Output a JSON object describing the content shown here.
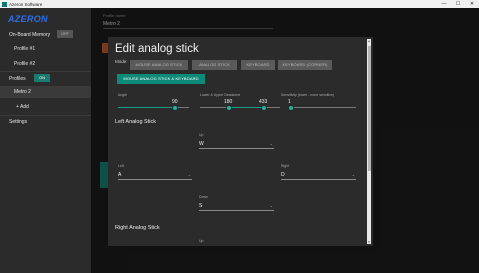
{
  "window": {
    "title": "Azeron Software",
    "controls": [
      "—",
      "☐",
      "✕"
    ]
  },
  "sidebar": {
    "logo": "AZERON",
    "onboard_memory": "On-Board Memory",
    "onboard_toggle": "OFF",
    "profile1": "Profile #1",
    "profile2": "Profile #2",
    "profiles_label": "Profiles",
    "profiles_toggle": "ON",
    "active_profile": "Metro 2",
    "add": "+ Add",
    "settings": "Settings"
  },
  "main": {
    "profile_name_label": "Profile name",
    "profile_name": "Metro 2"
  },
  "dialog": {
    "title": "Edit analog stick",
    "mode_label": "Mode:",
    "modes": [
      "MOUSE ANALOG STICK",
      "ANALOG STICK",
      "KEYBOARD",
      "KEYBOARD (CORNER)"
    ],
    "active_mode": "MOUSE ANALOG STICK & KEYBOARD",
    "angle_label": "Angle",
    "angle_value": "90",
    "deadzone_label": "Lower & Upper Deadzone",
    "deadzone_lower": "180",
    "deadzone_upper": "433",
    "sensitivity_label": "Sensitivity (lower - more sensitive)",
    "sensitivity_value": "1",
    "left_stick": "Left Analog Stick",
    "right_stick": "Right Analog Stick",
    "up_label": "Up",
    "up_value": "W",
    "left_label": "Left",
    "left_value": "A",
    "right_label": "Right",
    "right_value": "D",
    "down_label": "Down",
    "down_value": "S",
    "up2_label": "Up",
    "chev": "⌄"
  },
  "colors": {
    "accent": "#0d8a78",
    "logo": "#2f6ee6"
  }
}
